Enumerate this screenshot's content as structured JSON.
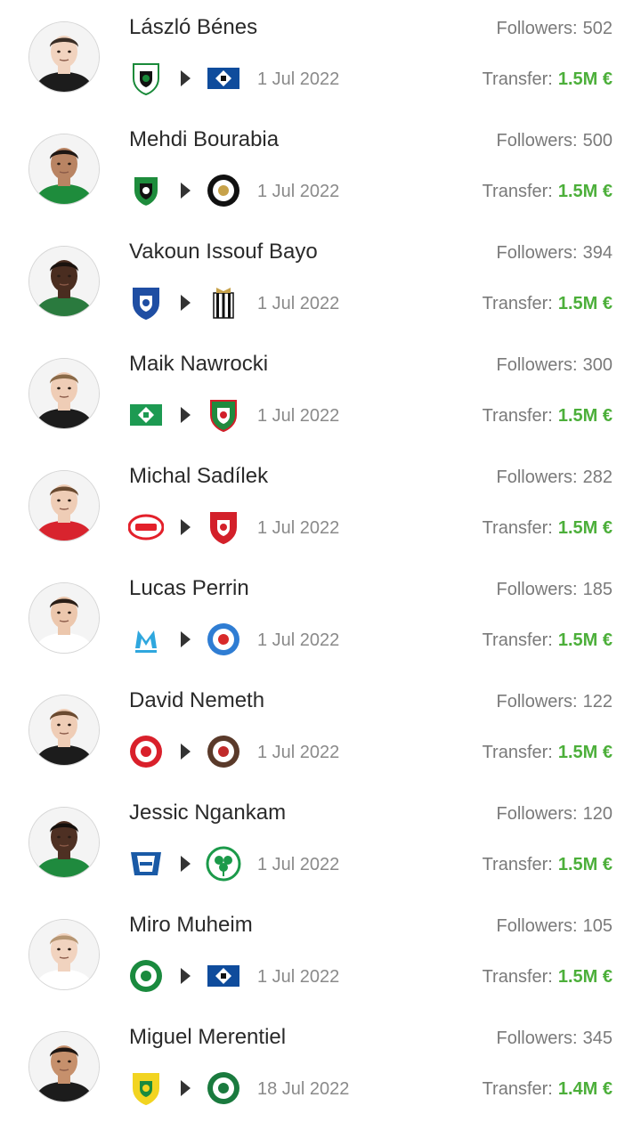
{
  "labels": {
    "followers": "Followers:",
    "transfer": "Transfer:"
  },
  "colors": {
    "fee": "#4caf3a",
    "text": "#2a2a2a",
    "muted": "#7a7a7a"
  },
  "transfers": [
    {
      "name": "László Bénes",
      "followers": "502",
      "date": "1 Jul 2022",
      "fee": "1.5M €",
      "skin": "#f1d3bf",
      "hair": "#3a2e26",
      "kit": "#1c1c1c",
      "from": {
        "icon": "gladbach-crest-icon",
        "shape": "shield",
        "c1": "#ffffff",
        "c2": "#111111",
        "c3": "#1a8a3a"
      },
      "to": {
        "icon": "hamburg-crest-icon",
        "shape": "diamond",
        "c1": "#0f4c9c",
        "c2": "#ffffff",
        "c3": "#111111"
      }
    },
    {
      "name": "Mehdi Bourabia",
      "followers": "500",
      "date": "1 Jul 2022",
      "fee": "1.5M €",
      "skin": "#b98463",
      "hair": "#1f1713",
      "kit": "#1e8c3c",
      "from": {
        "icon": "sassuolo-crest-icon",
        "shape": "shield",
        "c1": "#1e8c3c",
        "c2": "#111111",
        "c3": "#ffffff"
      },
      "to": {
        "icon": "spezia-crest-icon",
        "shape": "circle",
        "c1": "#111111",
        "c2": "#ffffff",
        "c3": "#c7a24a"
      }
    },
    {
      "name": "Vakoun Issouf Bayo",
      "followers": "394",
      "date": "1 Jul 2022",
      "fee": "1.5M €",
      "skin": "#4a2d20",
      "hair": "#1a120e",
      "kit": "#2a7a3e",
      "from": {
        "icon": "gent-crest-icon",
        "shape": "shield",
        "c1": "#1f4ea3",
        "c2": "#ffffff",
        "c3": "#1f4ea3"
      },
      "to": {
        "icon": "charleroi-crest-icon",
        "shape": "stripes",
        "c1": "#111111",
        "c2": "#ffffff",
        "c3": "#c7a24a"
      }
    },
    {
      "name": "Maik Nawrocki",
      "followers": "300",
      "date": "1 Jul 2022",
      "fee": "1.5M €",
      "skin": "#efcdb6",
      "hair": "#8a6a48",
      "kit": "#1c1c1c",
      "from": {
        "icon": "werder-crest-icon",
        "shape": "diamond",
        "c1": "#1d9a52",
        "c2": "#ffffff",
        "c3": "#1d9a52"
      },
      "to": {
        "icon": "legia-crest-icon",
        "shape": "shield",
        "c1": "#1f8a3e",
        "c2": "#ffffff",
        "c3": "#d21f2a"
      }
    },
    {
      "name": "Michal Sadílek",
      "followers": "282",
      "date": "1 Jul 2022",
      "fee": "1.5M €",
      "skin": "#efcdb6",
      "hair": "#6a4a30",
      "kit": "#d8242e",
      "from": {
        "icon": "psv-crest-icon",
        "shape": "oval",
        "c1": "#e3202a",
        "c2": "#ffffff",
        "c3": "#e3202a"
      },
      "to": {
        "icon": "twente-crest-icon",
        "shape": "shield",
        "c1": "#d3202a",
        "c2": "#ffffff",
        "c3": "#d3202a"
      }
    },
    {
      "name": "Lucas Perrin",
      "followers": "185",
      "date": "1 Jul 2022",
      "fee": "1.5M €",
      "skin": "#ecc7ad",
      "hair": "#2a1e17",
      "kit": "#ffffff",
      "from": {
        "icon": "marseille-crest-icon",
        "shape": "letter",
        "c1": "#2fa7de",
        "c2": "#ffffff",
        "c3": "#2fa7de"
      },
      "to": {
        "icon": "strasbourg-crest-icon",
        "shape": "circle",
        "c1": "#2f7dd3",
        "c2": "#ffffff",
        "c3": "#d82a2a"
      }
    },
    {
      "name": "David Nemeth",
      "followers": "122",
      "date": "1 Jul 2022",
      "fee": "1.5M €",
      "skin": "#efcdb6",
      "hair": "#6b4a30",
      "kit": "#1c1c1c",
      "from": {
        "icon": "mainz-crest-icon",
        "shape": "circle",
        "c1": "#d9202b",
        "c2": "#ffffff",
        "c3": "#d9202b"
      },
      "to": {
        "icon": "st-pauli-crest-icon",
        "shape": "circle",
        "c1": "#5a3a2a",
        "c2": "#ffffff",
        "c3": "#c02a2a"
      }
    },
    {
      "name": "Jessic Ngankam",
      "followers": "120",
      "date": "1 Jul 2022",
      "fee": "1.5M €",
      "skin": "#4e3023",
      "hair": "#15100d",
      "kit": "#1f8a3e",
      "from": {
        "icon": "hertha-crest-icon",
        "shape": "flag",
        "c1": "#1a5aa6",
        "c2": "#ffffff",
        "c3": "#1a5aa6"
      },
      "to": {
        "icon": "furth-crest-icon",
        "shape": "clover",
        "c1": "#1b9a4a",
        "c2": "#ffffff",
        "c3": "#1b9a4a"
      }
    },
    {
      "name": "Miro Muheim",
      "followers": "105",
      "date": "1 Jul 2022",
      "fee": "1.5M €",
      "skin": "#f1d3bf",
      "hair": "#b69673",
      "kit": "#ffffff",
      "from": {
        "icon": "st-gallen-crest-icon",
        "shape": "circle",
        "c1": "#1a8a3e",
        "c2": "#ffffff",
        "c3": "#1a8a3e"
      },
      "to": {
        "icon": "hamburg-crest-icon",
        "shape": "diamond",
        "c1": "#0f4c9c",
        "c2": "#ffffff",
        "c3": "#111111"
      }
    },
    {
      "name": "Miguel Merentiel",
      "followers": "345",
      "date": "18 Jul 2022",
      "fee": "1.4M €",
      "skin": "#c6906c",
      "hair": "#1e1612",
      "kit": "#1c1c1c",
      "from": {
        "icon": "defensa-crest-icon",
        "shape": "shield",
        "c1": "#f2d421",
        "c2": "#1a8a3e",
        "c3": "#f2d421"
      },
      "to": {
        "icon": "palmeiras-crest-icon",
        "shape": "circle",
        "c1": "#1a7a3e",
        "c2": "#ffffff",
        "c3": "#1a7a3e"
      }
    }
  ]
}
